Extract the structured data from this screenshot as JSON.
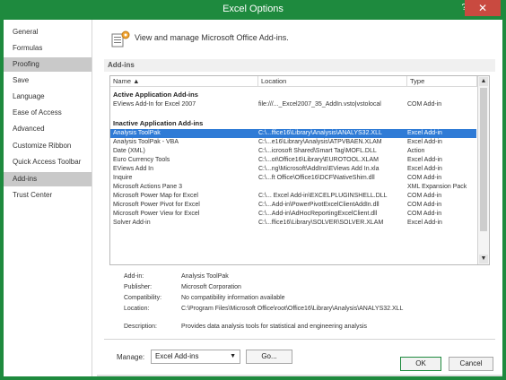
{
  "window": {
    "title": "Excel Options",
    "help": "?",
    "close": "✕"
  },
  "sidebar": {
    "items": [
      {
        "label": "General"
      },
      {
        "label": "Formulas"
      },
      {
        "label": "Proofing"
      },
      {
        "label": "Save"
      },
      {
        "label": "Language"
      },
      {
        "label": "Ease of Access"
      },
      {
        "label": "Advanced"
      },
      {
        "label": "Customize Ribbon"
      },
      {
        "label": "Quick Access Toolbar"
      },
      {
        "label": "Add-ins"
      },
      {
        "label": "Trust Center"
      }
    ]
  },
  "header": {
    "title": "View and manage Microsoft Office Add-ins."
  },
  "section": {
    "label": "Add-ins"
  },
  "table": {
    "columns": [
      "Name ▲",
      "Location",
      "Type"
    ],
    "groups": {
      "active": "Active Application Add-ins",
      "inactive": "Inactive Application Add-ins"
    },
    "active_rows": [
      {
        "name": "EViews Add-In for Excel 2007",
        "location": "file:///..._Excel2007_35_AddIn.vsto|vstolocal",
        "type": "COM Add-in"
      }
    ],
    "inactive_rows": [
      {
        "name": "Analysis ToolPak",
        "location": "C:\\...ffice16\\Library\\Analysis\\ANALYS32.XLL",
        "type": "Excel Add-in"
      },
      {
        "name": "Analysis ToolPak - VBA",
        "location": "C:\\...e16\\Library\\Analysis\\ATPVBAEN.XLAM",
        "type": "Excel Add-in"
      },
      {
        "name": "Date (XML)",
        "location": "C:\\...icrosoft Shared\\Smart Tag\\MOFL.DLL",
        "type": "Action"
      },
      {
        "name": "Euro Currency Tools",
        "location": "C:\\...ot\\Office16\\Library\\EUROTOOL.XLAM",
        "type": "Excel Add-in"
      },
      {
        "name": "EViews Add In",
        "location": "C:\\...ng\\Microsoft\\AddIns\\EViews Add In.xla",
        "type": "Excel Add-in"
      },
      {
        "name": "Inquire",
        "location": "C:\\...ft Office\\Office16\\DCF\\NativeShim.dll",
        "type": "COM Add-in"
      },
      {
        "name": "Microsoft Actions Pane 3",
        "location": "",
        "type": "XML Expansion Pack"
      },
      {
        "name": "Microsoft Power Map for Excel",
        "location": "C:\\... Excel Add-in\\EXCELPLUGINSHELL.DLL",
        "type": "COM Add-in"
      },
      {
        "name": "Microsoft Power Pivot for Excel",
        "location": "C:\\...Add-in\\PowerPivotExcelClientAddIn.dll",
        "type": "COM Add-in"
      },
      {
        "name": "Microsoft Power View for Excel",
        "location": "C:\\...Add-in\\AdHocReportingExcelClient.dll",
        "type": "COM Add-in"
      },
      {
        "name": "Solver Add-in",
        "location": "C:\\...ffice16\\Library\\SOLVER\\SOLVER.XLAM",
        "type": "Excel Add-in"
      }
    ]
  },
  "details": {
    "addin_label": "Add-in:",
    "addin_value": "Analysis ToolPak",
    "publisher_label": "Publisher:",
    "publisher_value": "Microsoft Corporation",
    "compat_label": "Compatibility:",
    "compat_value": "No compatibility information available",
    "location_label": "Location:",
    "location_value": "C:\\Program Files\\Microsoft Office\\root\\Office16\\Library\\Analysis\\ANALYS32.XLL",
    "description_label": "Description:",
    "description_value": "Provides data analysis tools for statistical and engineering analysis"
  },
  "manage": {
    "label": "Manage:",
    "value": "Excel Add-ins",
    "go": "Go..."
  },
  "footer": {
    "ok": "OK",
    "cancel": "Cancel"
  }
}
